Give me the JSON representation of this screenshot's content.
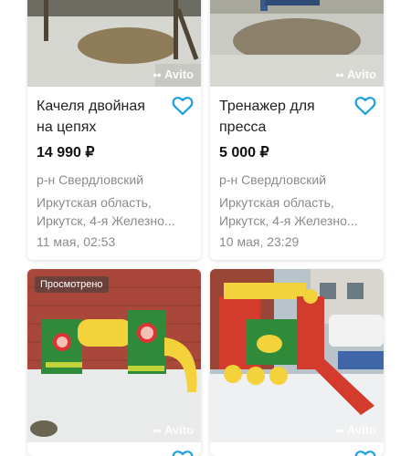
{
  "watermark": "Avito",
  "colors": {
    "heart": "#1a9fe0"
  },
  "listings": [
    {
      "title": "Качеля двойная на цепях",
      "price": "14 990 ₽",
      "district": "р-н Свердловский",
      "address": "Иркутская область, Иркутск, 4-я Железно...",
      "date": "11 мая, 02:53"
    },
    {
      "title": "Тренажер для пресса",
      "price": "5 000 ₽",
      "district": "р-н Свердловский",
      "address": "Иркутская область, Иркутск, 4-я Железно...",
      "date": "10 мая, 23:29"
    },
    {
      "badge": "Просмотрено"
    },
    {}
  ]
}
